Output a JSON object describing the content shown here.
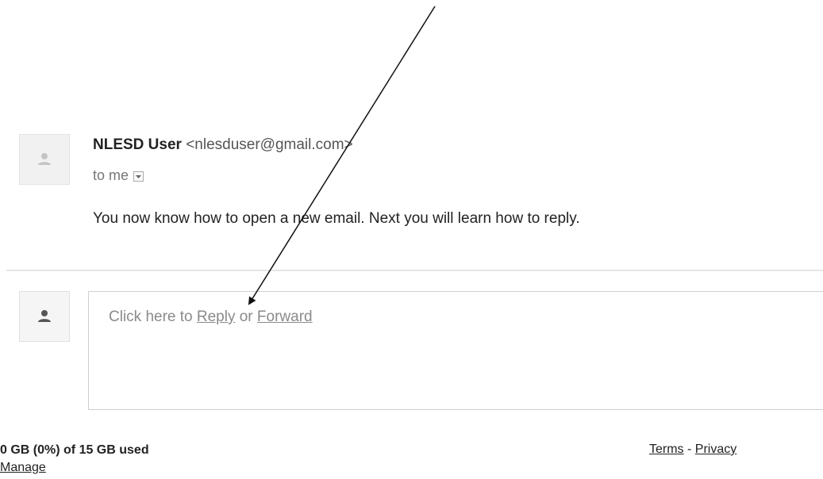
{
  "message": {
    "sender_name": "NLESD User",
    "sender_email": "<nlesduser@gmail.com>",
    "recipient_label": "to me",
    "body": "You now know how to open a new email.  Next you will learn how to reply."
  },
  "reply": {
    "prefix": "Click here to ",
    "reply_label": "Reply",
    "separator": " or ",
    "forward_label": "Forward"
  },
  "footer": {
    "storage_used": "0 GB (0%) of 15 GB used",
    "manage_label": "Manage",
    "terms_label": "Terms",
    "link_separator": " - ",
    "privacy_label": "Privacy"
  },
  "icons": {
    "sender_avatar": "person-icon",
    "reply_avatar": "person-icon",
    "recipient_dropdown": "caret-down-icon",
    "annotation": "arrow"
  },
  "colors": {
    "link_gray": "#8a8a8a",
    "text_dark": "#222222",
    "divider": "#e5e5e5"
  }
}
